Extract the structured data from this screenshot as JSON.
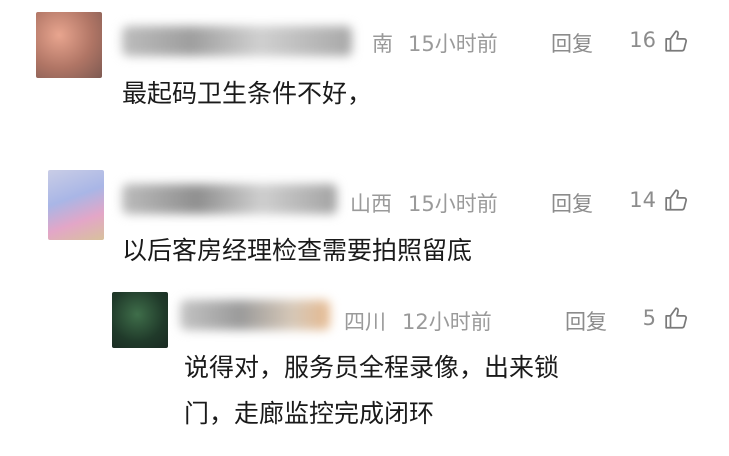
{
  "comments": [
    {
      "location": "南",
      "time": "15小时前",
      "reply_label": "回复",
      "likes": "16",
      "text": "最起码卫生条件不好，"
    },
    {
      "location": "山西",
      "time": "15小时前",
      "reply_label": "回复",
      "likes": "14",
      "text": "以后客房经理检查需要拍照留底"
    }
  ],
  "reply": {
    "location": "四川",
    "time": "12小时前",
    "reply_label": "回复",
    "likes": "5",
    "text_line1": "说得对，服务员全程录像，出来锁",
    "text_line2": "门，走廊监控完成闭环"
  },
  "icons": {
    "like": "thumbs-up-icon"
  },
  "colors": {
    "meta_text": "#9a9a9a",
    "body_text": "#1a1a1a"
  }
}
